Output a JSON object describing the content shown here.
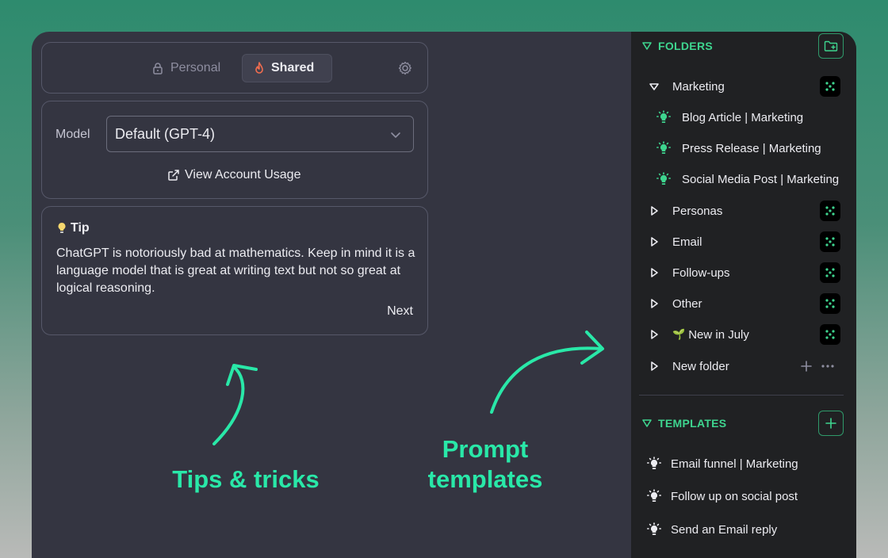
{
  "toggle": {
    "personal_label": "Personal",
    "shared_label": "Shared"
  },
  "model": {
    "label": "Model",
    "selected": "Default (GPT-4)",
    "usage_link": "View Account Usage"
  },
  "tip": {
    "title": "Tip",
    "body": "ChatGPT is notoriously bad at mathematics. Keep in mind it is a language model that is great at writing text but not so great at logical reasoning.",
    "next_label": "Next"
  },
  "annotations": {
    "tips": "Tips & tricks",
    "prompt_line1": "Prompt",
    "prompt_line2": "templates"
  },
  "sidebar": {
    "folders_title": "FOLDERS",
    "folders": [
      {
        "name": "Marketing",
        "expanded": true,
        "icon": "dots-badge"
      },
      {
        "name": "Blog Article | Marketing",
        "type": "prompt",
        "icon": "lightbulb-icon"
      },
      {
        "name": "Press Release | Marketing",
        "type": "prompt",
        "icon": "lightbulb-icon"
      },
      {
        "name": "Social Media Post | Marketing",
        "type": "prompt",
        "icon": "lightbulb-icon"
      },
      {
        "name": "Personas",
        "expanded": false,
        "icon": "dots-badge"
      },
      {
        "name": "Email",
        "expanded": false,
        "icon": "dots-badge"
      },
      {
        "name": "Follow-ups",
        "expanded": false,
        "icon": "dots-badge"
      },
      {
        "name": "Other",
        "expanded": false,
        "icon": "dots-badge"
      },
      {
        "name": "New in July",
        "expanded": false,
        "icon": "dots-badge",
        "emoji": "🌱"
      },
      {
        "name": "New folder",
        "expanded": false
      }
    ],
    "templates_title": "TEMPLATES",
    "templates": [
      {
        "name": "Email funnel | Marketing"
      },
      {
        "name": "Follow up on social post"
      },
      {
        "name": "Send an Email reply"
      }
    ]
  },
  "colors": {
    "accent": "#3ed58f",
    "annotation": "#29e8a8",
    "panel_bg": "#343541",
    "sidebar_bg": "#202123",
    "shared_flame": "#f26d4f"
  }
}
